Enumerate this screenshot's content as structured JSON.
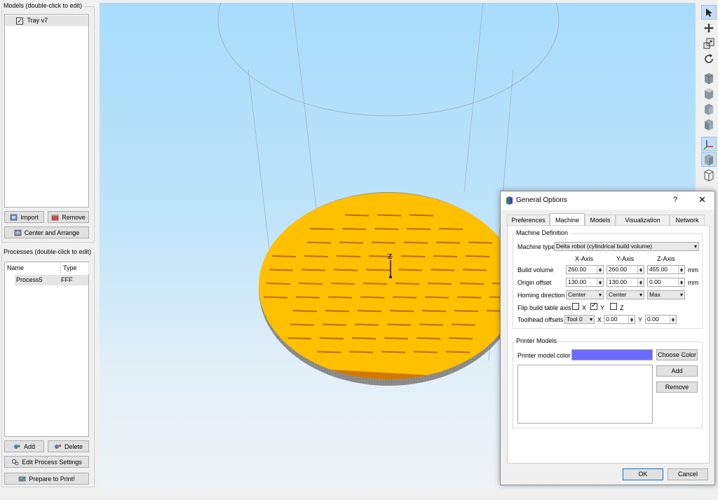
{
  "models_panel": {
    "title": "Models (double-click to edit)",
    "items": [
      {
        "label": "Tray v7",
        "checked": true
      }
    ],
    "import_label": "Import",
    "remove_label": "Remove",
    "center_arrange_label": "Center and Arrange"
  },
  "processes_panel": {
    "title": "Processes (double-click to edit)",
    "columns": [
      "Name",
      "Type"
    ],
    "rows": [
      {
        "name": "Process5",
        "type": "FFF"
      }
    ],
    "add_label": "Add",
    "delete_label": "Delete",
    "edit_label": "Edit Process Settings",
    "prepare_label": "Prepare to Print!"
  },
  "viewport": {
    "axis_label": "Z",
    "bed_color": "#ffc000",
    "sky_color": "#a8dcfc"
  },
  "toolbar": {
    "icons": [
      "select-arrow-icon",
      "move-icon",
      "scale-icon",
      "rotate-icon",
      "view-front-cube-icon",
      "view-top-cube-icon",
      "view-side-cube-icon",
      "view-iso-cube-icon",
      "axes-icon",
      "solid-cube-icon",
      "wireframe-cube-icon"
    ]
  },
  "dialog": {
    "title": "General Options",
    "help": "?",
    "close": "✕",
    "tabs": [
      "Preferences",
      "Machine",
      "Models",
      "Visualization",
      "Network"
    ],
    "active_tab": "Machine",
    "machine_definition": {
      "title": "Machine Definition",
      "machine_type_label": "Machine type",
      "machine_type_value": "Delta robot (cylindrical build volume)",
      "axis_headers": [
        "X-Axis",
        "Y-Axis",
        "Z-Axis"
      ],
      "build_volume_label": "Build volume",
      "build_volume": [
        "260.00",
        "260.00",
        "455.00"
      ],
      "origin_offset_label": "Origin offset",
      "origin_offset": [
        "130.00",
        "130.00",
        "0.00"
      ],
      "unit": "mm",
      "homing_label": "Homing direction",
      "homing": [
        "Center",
        "Center",
        "Max"
      ],
      "flip_label": "Flip build table axis",
      "flip": [
        {
          "axis": "X",
          "checked": false
        },
        {
          "axis": "Y",
          "checked": true
        },
        {
          "axis": "Z",
          "checked": false
        }
      ],
      "toolhead_label": "Toolhead offsets",
      "tool_value": "Tool 0",
      "x_label": "X",
      "x_value": "0.00",
      "y_label": "Y",
      "y_value": "0.00"
    },
    "printer_models": {
      "title": "Printer Models",
      "color_label": "Printer model color",
      "color": "#6b6bff",
      "choose_color_label": "Choose Color",
      "add_label": "Add",
      "remove_label": "Remove"
    },
    "ok_label": "OK",
    "cancel_label": "Cancel"
  }
}
